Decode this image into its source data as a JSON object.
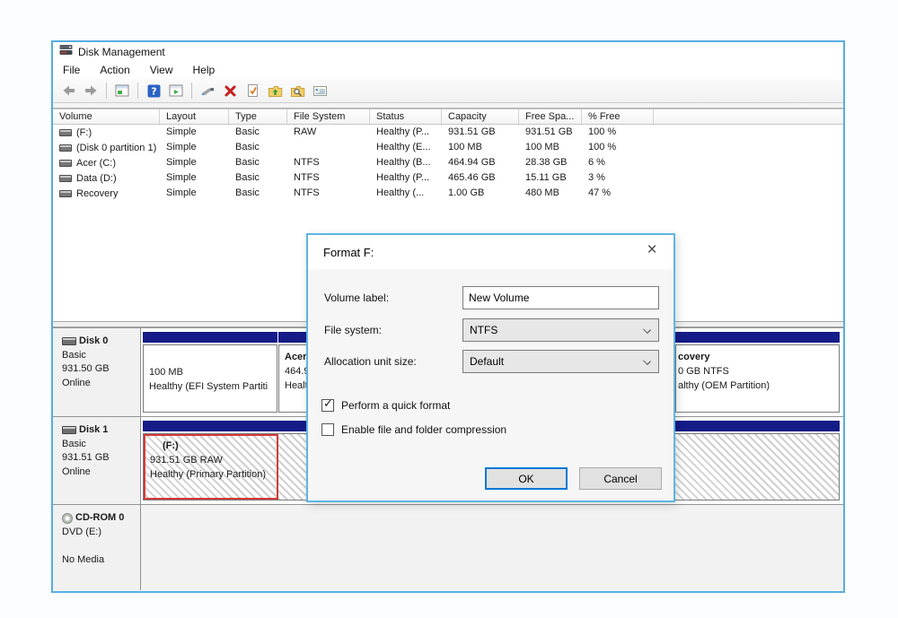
{
  "window": {
    "title": "Disk Management"
  },
  "menubar": {
    "items": [
      "File",
      "Action",
      "View",
      "Help"
    ]
  },
  "toolbar": {
    "icons": [
      "back-arrow",
      "forward-arrow",
      "console-window",
      "help",
      "console-play",
      "rescan",
      "delete-x",
      "check-document",
      "folder-up",
      "folder-search",
      "properties"
    ]
  },
  "volume_table": {
    "columns": [
      "Volume",
      "Layout",
      "Type",
      "File System",
      "Status",
      "Capacity",
      "Free Spa...",
      "% Free"
    ],
    "rows": [
      {
        "volume": "(F:)",
        "layout": "Simple",
        "type": "Basic",
        "file_system": "RAW",
        "status": "Healthy (P...",
        "capacity": "931.51 GB",
        "free_space": "931.51 GB",
        "pct_free": "100 %"
      },
      {
        "volume": "(Disk 0 partition 1)",
        "layout": "Simple",
        "type": "Basic",
        "file_system": "",
        "status": "Healthy (E...",
        "capacity": "100 MB",
        "free_space": "100 MB",
        "pct_free": "100 %"
      },
      {
        "volume": "Acer (C:)",
        "layout": "Simple",
        "type": "Basic",
        "file_system": "NTFS",
        "status": "Healthy (B...",
        "capacity": "464.94 GB",
        "free_space": "28.38 GB",
        "pct_free": "6 %"
      },
      {
        "volume": "Data (D:)",
        "layout": "Simple",
        "type": "Basic",
        "file_system": "NTFS",
        "status": "Healthy (P...",
        "capacity": "465.46 GB",
        "free_space": "15.11 GB",
        "pct_free": "3 %"
      },
      {
        "volume": "Recovery",
        "layout": "Simple",
        "type": "Basic",
        "file_system": "NTFS",
        "status": "Healthy (...",
        "capacity": "1.00 GB",
        "free_space": "480 MB",
        "pct_free": "47 %"
      }
    ]
  },
  "graphic_view": {
    "disk0": {
      "name": "Disk 0",
      "type": "Basic",
      "size": "931.50 GB",
      "status": "Online",
      "partitions": [
        {
          "line1": "100 MB",
          "line2": "Healthy (EFI System Partiti"
        },
        {
          "line1": "Acer",
          "line2": "464.9",
          "line3": "Healt"
        },
        {
          "line1": "covery",
          "line2": "0 GB NTFS",
          "line3": "althy (OEM Partition)"
        }
      ]
    },
    "disk1": {
      "name": "Disk 1",
      "type": "Basic",
      "size": "931.51 GB",
      "status": "Online",
      "partitions": [
        {
          "line1": "(F:)",
          "line2": "931.51 GB RAW",
          "line3": "Healthy (Primary Partition)"
        }
      ]
    },
    "cdrom": {
      "name": "CD-ROM 0",
      "drive": "DVD (E:)",
      "media": "No Media"
    }
  },
  "dialog": {
    "title": "Format F:",
    "close_glyph": "×",
    "fields": [
      {
        "label": "Volume label:",
        "value": "New Volume"
      },
      {
        "label": "File system:",
        "value": "NTFS"
      },
      {
        "label": "Allocation unit size:",
        "value": "Default"
      }
    ],
    "checkboxes": [
      {
        "label": "Perform a quick format",
        "checked": true
      },
      {
        "label": "Enable file and folder compression",
        "checked": false
      }
    ],
    "buttons": {
      "ok": "OK",
      "cancel": "Cancel"
    }
  },
  "colors": {
    "window_border": "#58ade0",
    "partition_bar_navy": "#151c87",
    "selection_red": "#d63a3a",
    "ok_button_border": "#0078d7"
  }
}
